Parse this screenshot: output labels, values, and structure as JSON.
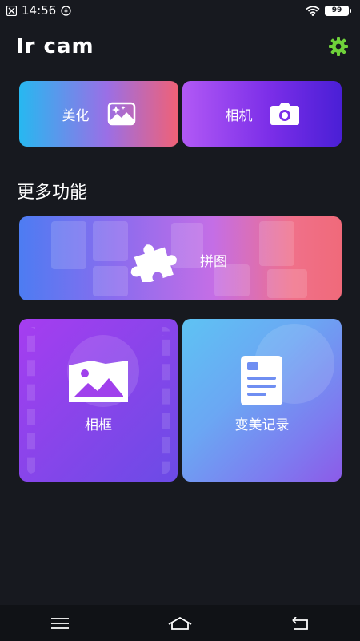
{
  "status_bar": {
    "time": "14:56",
    "battery": "99"
  },
  "header": {
    "title": "Ir cam",
    "accent_color": "#6fd13a"
  },
  "top_cards": {
    "beautify_label": "美化",
    "camera_label": "相机"
  },
  "section": {
    "more_features": "更多功能"
  },
  "features": {
    "collage_label": "拼图",
    "frame_label": "相框",
    "history_label": "变美记录"
  },
  "icons": {
    "settings": "gear-icon",
    "beautify": "image-sparkle-icon",
    "camera": "camera-icon",
    "collage": "puzzle-icon",
    "frame": "landscape-frame-icon",
    "history": "document-icon"
  }
}
